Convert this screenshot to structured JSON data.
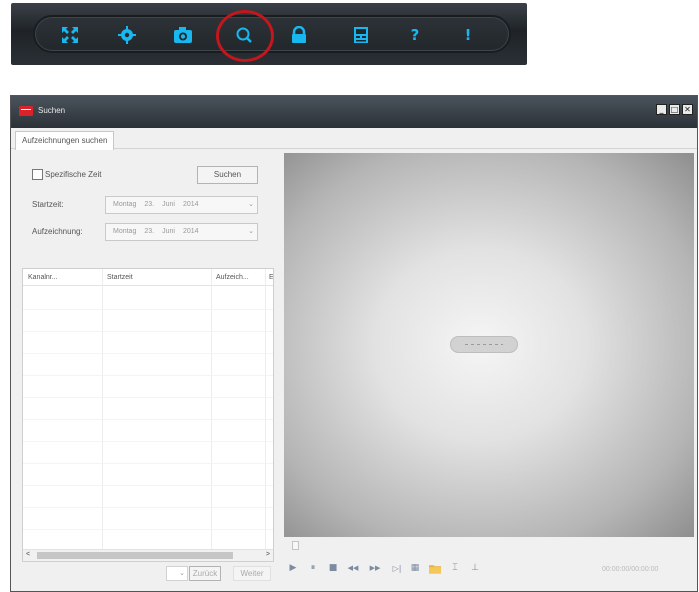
{
  "toolbar": {
    "buttons": [
      {
        "icon": "fullscreen-icon"
      },
      {
        "icon": "gear-icon"
      },
      {
        "icon": "camera-icon"
      },
      {
        "icon": "search-icon",
        "highlighted": true
      },
      {
        "icon": "user-lock-icon"
      },
      {
        "icon": "window-layout-icon"
      },
      {
        "icon": "help-icon",
        "glyph": "?"
      },
      {
        "icon": "alert-icon",
        "glyph": "!"
      }
    ],
    "accent": "#19b7f0",
    "highlight_color": "#c3161d"
  },
  "window": {
    "title": "Suchen",
    "controls": {
      "minimize": "_",
      "maximize": "□",
      "close": "✕"
    }
  },
  "tab": {
    "label": "Aufzeichnungen suchen"
  },
  "search": {
    "specific_time_label": "Spezifische Zeit",
    "search_button": "Suchen",
    "start_label": "Startzeit:",
    "end_label": "Aufzeichnung:",
    "start_value": {
      "weekday": "Montag",
      "day": "23.",
      "month": "Juni",
      "year": "2014"
    },
    "end_value": {
      "weekday": "Montag",
      "day": "23.",
      "month": "Juni",
      "year": "2014"
    }
  },
  "results": {
    "columns": [
      "Kanalnr...",
      "Startzeit",
      "Aufzeich...",
      "E"
    ],
    "rows": []
  },
  "pager": {
    "dropdown_value": "",
    "back_button": "Zurück",
    "next_button": "Weiter"
  },
  "player": {
    "controls": [
      {
        "icon": "play-icon",
        "glyph": "▶"
      },
      {
        "icon": "pause-icon",
        "glyph": "⏸"
      },
      {
        "icon": "stop-icon",
        "glyph": "■"
      },
      {
        "icon": "slow-icon",
        "glyph": "◀◀"
      },
      {
        "icon": "fast-icon",
        "glyph": "▶▶"
      },
      {
        "icon": "frame-step-icon",
        "glyph": "▷|"
      },
      {
        "icon": "snapshot-icon",
        "glyph": "▦"
      },
      {
        "icon": "folder-icon",
        "glyph": ""
      },
      {
        "icon": "clip-start-icon",
        "glyph": "⌶"
      },
      {
        "icon": "clip-end-icon",
        "glyph": "⊥"
      }
    ],
    "timecode": "00:00:00/00:00:00"
  }
}
